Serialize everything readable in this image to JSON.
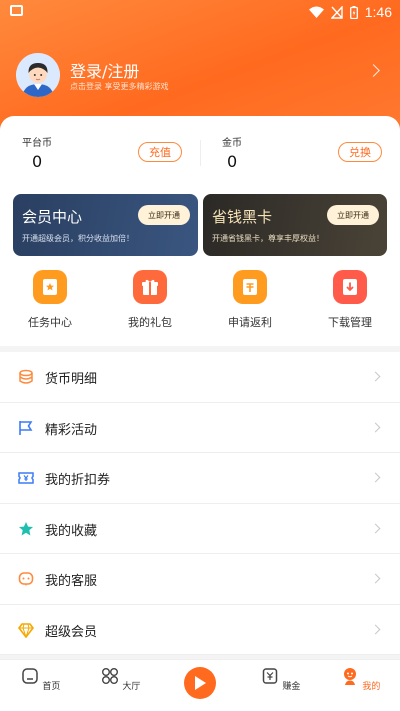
{
  "status_bar": {
    "time": "1:46"
  },
  "account": {
    "title": "登录/注册",
    "subtitle": "点击登录  享受更多精彩游戏"
  },
  "wallet": {
    "platform_coin": {
      "label": "平台币",
      "value": "0",
      "button": "充值"
    },
    "gold_coin": {
      "label": "金币",
      "value": "0",
      "button": "兑换"
    }
  },
  "cards": [
    {
      "title": "会员中心",
      "desc": "开通超级会员，积分收益加倍！",
      "button": "立即开通"
    },
    {
      "title": "省钱黑卡",
      "desc": "开通省钱黑卡，尊享丰厚权益！",
      "button": "立即开通"
    }
  ],
  "quick_actions": [
    {
      "label": "任务中心",
      "icon": "task-center-icon",
      "color": "#ff9b1f"
    },
    {
      "label": "我的礼包",
      "icon": "gift-icon",
      "color": "#ff6a3d"
    },
    {
      "label": "申请返利",
      "icon": "rebate-icon",
      "color": "#ff9b1f"
    },
    {
      "label": "下载管理",
      "icon": "download-icon",
      "color": "#ff5a4a"
    }
  ],
  "menu": [
    {
      "label": "货币明细",
      "icon": "coins-icon",
      "color": "#ff8a3d"
    },
    {
      "label": "精彩活动",
      "icon": "flag-icon",
      "color": "#3b7cf5"
    },
    {
      "label": "我的折扣券",
      "icon": "coupon-icon",
      "color": "#3b7cf5"
    },
    {
      "label": "我的收藏",
      "icon": "star-icon",
      "color": "#1fbfb0"
    },
    {
      "label": "我的客服",
      "icon": "service-icon",
      "color": "#ff8a3d"
    },
    {
      "label": "超级会员",
      "icon": "diamond-icon",
      "color": "#f6a800"
    }
  ],
  "tabs": [
    {
      "label": "首页",
      "icon": "home-icon"
    },
    {
      "label": "大厅",
      "icon": "grid-icon"
    },
    {
      "label": "",
      "icon": "play-icon"
    },
    {
      "label": "赚金",
      "icon": "earn-icon"
    },
    {
      "label": "我的",
      "icon": "profile-icon",
      "active": true
    }
  ]
}
